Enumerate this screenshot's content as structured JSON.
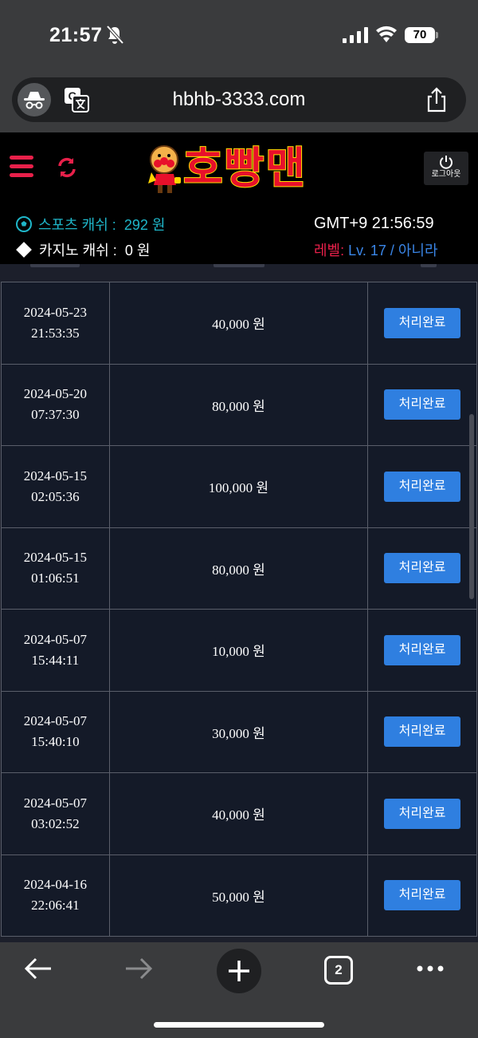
{
  "status_bar": {
    "time": "21:57",
    "battery": "70"
  },
  "browser": {
    "url": "hbhb-3333.com"
  },
  "site": {
    "logo_text": "호빵맨",
    "logout_label": "로그아웃",
    "sports_cash_label": "스포츠 캐쉬 :",
    "sports_cash_value": "292 원",
    "casino_cash_label": "카지노 캐쉬 :",
    "casino_cash_value": "0 원",
    "gmt_time": "GMT+9 21:56:59",
    "level_label": "레벨:",
    "level_value": "Lv. 17 / 아니라"
  },
  "transactions": [
    {
      "date": "2024-05-23",
      "time": "21:53:35",
      "amount": "40,000 원",
      "status": "처리완료"
    },
    {
      "date": "2024-05-20",
      "time": "07:37:30",
      "amount": "80,000 원",
      "status": "처리완료"
    },
    {
      "date": "2024-05-15",
      "time": "02:05:36",
      "amount": "100,000 원",
      "status": "처리완료"
    },
    {
      "date": "2024-05-15",
      "time": "01:06:51",
      "amount": "80,000 원",
      "status": "처리완료"
    },
    {
      "date": "2024-05-07",
      "time": "15:44:11",
      "amount": "10,000 원",
      "status": "처리완료"
    },
    {
      "date": "2024-05-07",
      "time": "15:40:10",
      "amount": "30,000 원",
      "status": "처리완료"
    },
    {
      "date": "2024-05-07",
      "time": "03:02:52",
      "amount": "40,000 원",
      "status": "처리완료"
    },
    {
      "date": "2024-04-16",
      "time": "22:06:41",
      "amount": "50,000 원",
      "status": "처리완료"
    }
  ],
  "toolbar": {
    "tab_count": "2"
  },
  "colors": {
    "accent_red": "#e8204a",
    "accent_blue": "#2f7fe0",
    "cash_teal": "#1fb6c9"
  }
}
